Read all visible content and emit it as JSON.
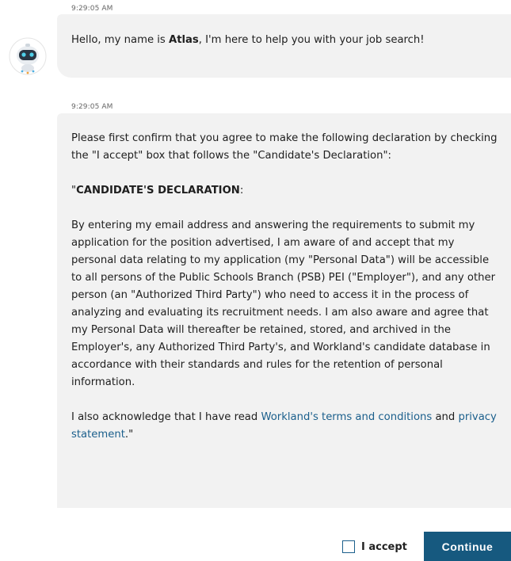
{
  "messages": [
    {
      "timestamp": "9:29:05 AM",
      "greeting_pre": "Hello, my name is ",
      "greeting_name": "Atlas",
      "greeting_post": ", I'm here to help you with your job search!"
    },
    {
      "timestamp": "9:29:05 AM",
      "intro": "Please first confirm that you agree to make the following declaration by checking the \"I accept\" box that follows the \"Candidate's Declaration\":",
      "heading_prefix": "\"",
      "heading": "CANDIDATE'S DECLARATION",
      "heading_suffix": ":",
      "declaration": "By entering my email address and answering the requirements to submit my application for the position advertised, I am aware of and accept that my personal data relating to my application (my \"Personal Data\") will be accessible to all persons of the Public Schools Branch (PSB) PEI (\"Employer\"), and any other person (an \"Authorized Third Party\") who need to access it in the process of analyzing and evaluating its recruitment needs. I am also aware and agree that my Personal Data will thereafter be retained, stored, and archived in the Employer's, any Authorized Third Party's, and Workland's candidate database in accordance with their standards and rules for the retention of personal information.",
      "ack_pre": "I also acknowledge that I have read ",
      "terms_link": "Workland's terms and conditions",
      "ack_mid": " and ",
      "privacy_link": "privacy statement",
      "ack_post": ".\""
    }
  ],
  "footer": {
    "accept_label": "I accept",
    "continue_label": "Continue"
  },
  "avatar_icon": "robot-avatar-icon",
  "colors": {
    "accent": "#16597f",
    "link": "#1b5f8c",
    "bubble": "#f2f2f2"
  }
}
